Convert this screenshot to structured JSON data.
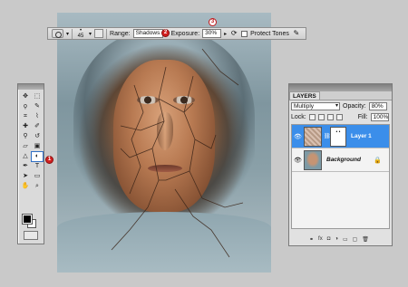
{
  "options_bar": {
    "brush_size": "45",
    "range_label": "Range:",
    "range_value": "Shadows",
    "exposure_label": "Exposure:",
    "exposure_value": "30%",
    "protect_tones_label": "Protect Tones"
  },
  "callouts": [
    "1",
    "2",
    "3"
  ],
  "tools_panel": {
    "tools": [
      {
        "icon": "move-icon",
        "glyph": "✥"
      },
      {
        "icon": "marquee-icon",
        "glyph": "⬚"
      },
      {
        "icon": "lasso-icon",
        "glyph": "ϙ"
      },
      {
        "icon": "quick-select-icon",
        "glyph": "✎"
      },
      {
        "icon": "crop-icon",
        "glyph": "⌗"
      },
      {
        "icon": "eyedropper-icon",
        "glyph": "⌇"
      },
      {
        "icon": "healing-brush-icon",
        "glyph": "✚"
      },
      {
        "icon": "brush-icon",
        "glyph": "✐"
      },
      {
        "icon": "clone-stamp-icon",
        "glyph": "⚲"
      },
      {
        "icon": "history-brush-icon",
        "glyph": "↺"
      },
      {
        "icon": "eraser-icon",
        "glyph": "▱"
      },
      {
        "icon": "gradient-icon",
        "glyph": "▣"
      },
      {
        "icon": "blur-icon",
        "glyph": "△"
      },
      {
        "icon": "burn-tool-icon",
        "glyph": "◐"
      },
      {
        "icon": "pen-icon",
        "glyph": "✒"
      },
      {
        "icon": "type-icon",
        "glyph": "T"
      },
      {
        "icon": "path-select-icon",
        "glyph": "➤"
      },
      {
        "icon": "shape-icon",
        "glyph": "▭"
      },
      {
        "icon": "hand-icon",
        "glyph": "✋"
      },
      {
        "icon": "zoom-icon",
        "glyph": "⌕"
      }
    ],
    "active_tool": "burn-tool-icon",
    "foreground_color": "#000000",
    "background_color": "#ffffff"
  },
  "layers_panel": {
    "tab_label": "LAYERS",
    "blend_mode": "Multiply",
    "opacity_label": "Opacity:",
    "opacity_value": "80%",
    "lock_label": "Lock:",
    "fill_label": "Fill:",
    "fill_value": "100%",
    "layers": [
      {
        "name": "Layer 1",
        "selected": true
      },
      {
        "name": "Background",
        "selected": false
      }
    ]
  }
}
